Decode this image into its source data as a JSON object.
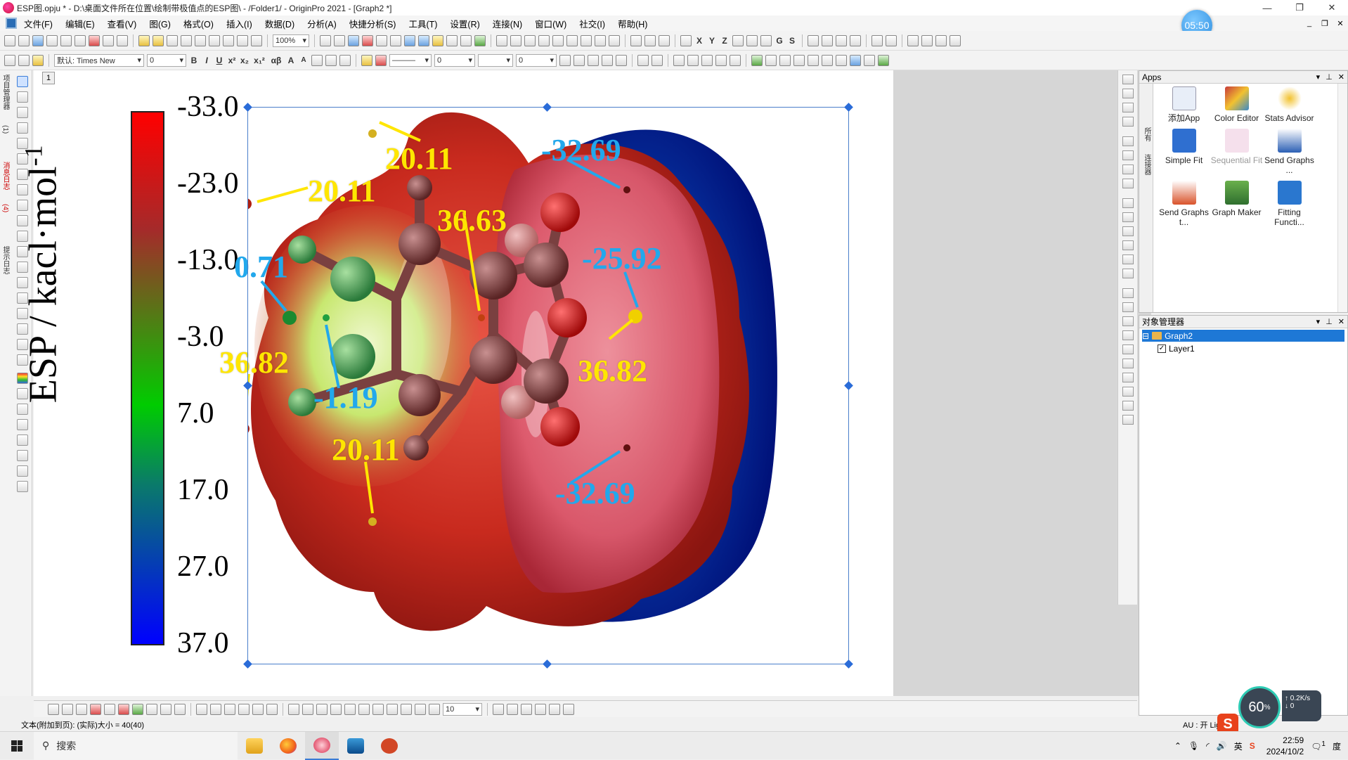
{
  "window": {
    "title": "ESP图.opju * - D:\\桌面文件所在位置\\绘制带极值点的ESP图\\ - /Folder1/ - OriginPro 2021 - [Graph2 *]",
    "controls": [
      "—",
      "❐",
      "✕"
    ]
  },
  "menu": [
    "文件(F)",
    "编辑(E)",
    "查看(V)",
    "图(G)",
    "格式(O)",
    "插入(I)",
    "数据(D)",
    "分析(A)",
    "快捷分析(S)",
    "工具(T)",
    "设置(R)",
    "连接(N)",
    "窗口(W)",
    "社交(I)",
    "帮助(H)"
  ],
  "clock_bubble": "05:50",
  "toolbar": {
    "zoom": "100%",
    "font": "默认: Times New",
    "font_size": "0",
    "format_buttons": [
      "B",
      "I",
      "U",
      "x²",
      "x₂",
      "x₁²",
      "αβ",
      "A",
      "A"
    ],
    "line_width": "0",
    "arrow_size": "0",
    "right_letters": [
      "X",
      "Y",
      "Z",
      "G",
      "S"
    ],
    "bottom_size": "10"
  },
  "left_tabs": [
    "项目管理器",
    "(1)",
    "消息日志",
    "(4)",
    "提示日志"
  ],
  "page_tab": "1",
  "colorbar": {
    "ticks": [
      "-33.0",
      "-23.0",
      "-13.0",
      "-3.0",
      "7.0",
      "17.0",
      "27.0",
      "37.0"
    ],
    "label": "ESP / kacl·mol",
    "label_sup": "-1",
    "colors": [
      "#ff0000",
      "#a52a2a",
      "#00cc00",
      "#0a7a6a",
      "#0000ff"
    ]
  },
  "annotations": {
    "yellow": [
      "20.11",
      "20.11",
      "36.63",
      "36.82",
      "36.82",
      "20.11"
    ],
    "blue": [
      "-32.69",
      "0.71",
      "-25.92",
      "-1.19",
      "-32.69"
    ],
    "yellow_color": "#ffe600",
    "blue_color": "#22a8ec"
  },
  "apps": {
    "title": "Apps",
    "side_tabs": [
      "所有",
      "连接器"
    ],
    "tiles": [
      {
        "label": "添加App",
        "icon": "add-app-icon",
        "color": "#e8eef8"
      },
      {
        "label": "Color Editor",
        "icon": "color-editor-icon",
        "color": "#c83a3a"
      },
      {
        "label": "Stats Advisor",
        "icon": "stats-advisor-icon",
        "color": "#f2c230"
      },
      {
        "label": "Simple Fit",
        "icon": "simple-fit-icon",
        "color": "#2f6fd0"
      },
      {
        "label": "Sequential Fit",
        "icon": "sequential-fit-icon",
        "color": "#e8c0d8"
      },
      {
        "label": "Send Graphs ...",
        "icon": "send-graphs-word-icon",
        "color": "#2b5fb4"
      },
      {
        "label": "Send Graphs t...",
        "icon": "send-graphs-ppt-icon",
        "color": "#d9532b"
      },
      {
        "label": "Graph Maker",
        "icon": "graph-maker-icon",
        "color": "#3c8c3c"
      },
      {
        "label": "Fitting Functi...",
        "icon": "fitting-function-icon",
        "color": "#2a77cf"
      }
    ]
  },
  "object_manager": {
    "title": "对象管理器",
    "graph": "Graph2",
    "layer": "Layer1"
  },
  "status": {
    "text": "文本(附加到页): (实际)大小 = 40(40)",
    "au": "AU : 开  Light G"
  },
  "speed": {
    "percent": "60",
    "unit": "%",
    "up": "0.2",
    "up_unit": "K/s",
    "down": "0"
  },
  "taskbar": {
    "search_placeholder": "搜索",
    "tray_lang": "英",
    "ime": "S",
    "time": "22:59",
    "date": "2024/10/2",
    "notif_count": "1",
    "right_edge_text": "度"
  }
}
